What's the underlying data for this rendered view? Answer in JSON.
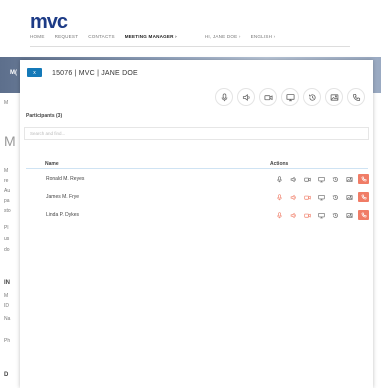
{
  "brand": {
    "logo_text": "mvc"
  },
  "top_nav": {
    "home": "HOME",
    "request": "REQUEST",
    "contacts": "CONTACTS",
    "meeting_manager": "MEETING MANAGER ›",
    "user": "HI, JANE DOE ›",
    "language": "ENGLISH ›"
  },
  "background": {
    "banner_text": "M(",
    "fragments": [
      "M",
      "M",
      "M",
      "re",
      "Au",
      "pa",
      "sto",
      "Pl",
      "us",
      "do",
      "IN",
      "M",
      "ID",
      "Na",
      "Ph",
      "D"
    ]
  },
  "modal": {
    "close_label": "x",
    "title": "15076 | MVC | JANE DOE",
    "toolbar": [
      {
        "icon": "microphone-icon",
        "name": "toolbar-mic-button"
      },
      {
        "icon": "speaker-icon",
        "name": "toolbar-speaker-button"
      },
      {
        "icon": "video-camera-icon",
        "name": "toolbar-camera-button"
      },
      {
        "icon": "monitor-icon",
        "name": "toolbar-screen-button"
      },
      {
        "icon": "history-icon",
        "name": "toolbar-history-button"
      },
      {
        "icon": "image-icon",
        "name": "toolbar-image-button"
      },
      {
        "icon": "phone-icon",
        "name": "toolbar-phone-button"
      }
    ],
    "participants_label": "Participants (3)",
    "search_placeholder": "Search and find...",
    "table": {
      "col_name": "Name",
      "col_actions": "Actions",
      "rows": [
        {
          "name": "Ronald M. Reyes",
          "muted": false
        },
        {
          "name": "James M. Frye",
          "muted": true
        },
        {
          "name": "Linda P. Dykes",
          "muted": true
        }
      ]
    }
  },
  "colors": {
    "brand_blue": "#1d3b86",
    "close_button": "#1479b8",
    "hangup": "#f07c66",
    "muted_icon": "#f07c66",
    "icon_gray": "#666666"
  }
}
